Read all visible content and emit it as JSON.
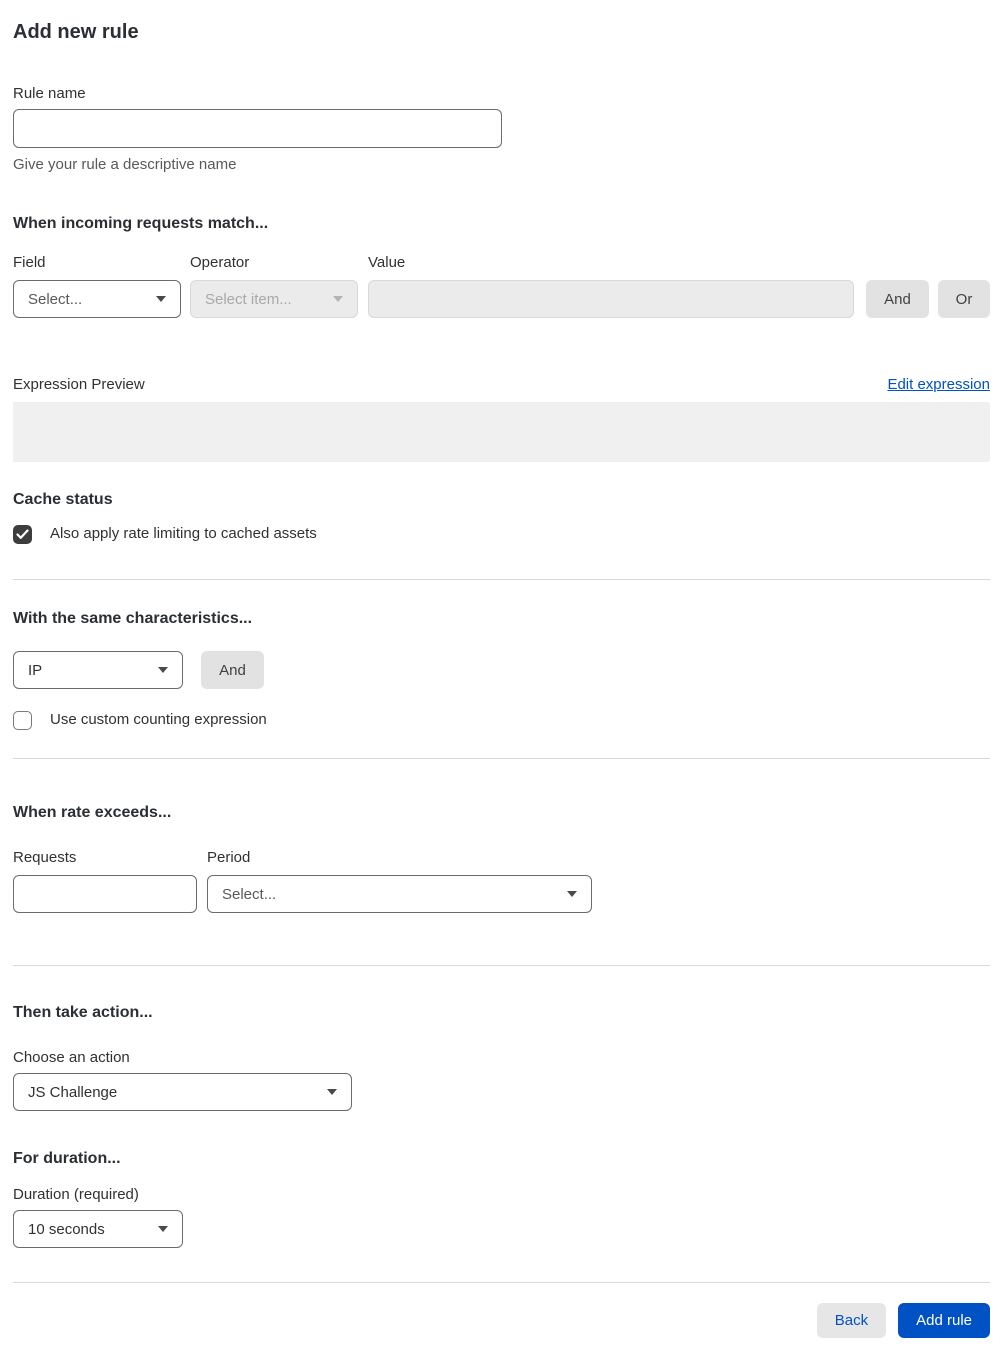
{
  "page": {
    "title": "Add new rule"
  },
  "rule_name": {
    "label": "Rule name",
    "value": "",
    "placeholder": "",
    "helper": "Give your rule a descriptive name"
  },
  "match_section": {
    "heading": "When incoming requests match...",
    "field": {
      "label": "Field",
      "selected": "Select..."
    },
    "operator": {
      "label": "Operator",
      "selected": "Select item...",
      "disabled": true
    },
    "value": {
      "label": "Value",
      "value": "",
      "disabled": true
    },
    "and_button": "And",
    "or_button": "Or"
  },
  "expression": {
    "label": "Expression Preview",
    "edit_link": "Edit expression",
    "preview_value": ""
  },
  "cache_section": {
    "heading": "Cache status",
    "checkbox_label": "Also apply rate limiting to cached assets",
    "checked": true
  },
  "characteristics_section": {
    "heading": "With the same characteristics...",
    "characteristic": {
      "selected": "IP"
    },
    "and_button": "And",
    "checkbox_label": "Use custom counting expression",
    "checked": false
  },
  "rate_section": {
    "heading": "When rate exceeds...",
    "requests": {
      "label": "Requests",
      "value": ""
    },
    "period": {
      "label": "Period",
      "selected": "Select..."
    }
  },
  "action_section": {
    "heading": "Then take action...",
    "label": "Choose an action",
    "selected": "JS Challenge"
  },
  "duration_section": {
    "heading": "For duration...",
    "label": "Duration (required)",
    "selected": "10 seconds"
  },
  "footer": {
    "back_button": "Back",
    "add_rule_button": "Add rule"
  },
  "colors": {
    "accent_blue": "#0051c3",
    "heading_text": "#2b2f33",
    "body_text": "#313131",
    "muted_text": "#595959",
    "disabled_bg": "#ebebeb",
    "disabled_border": "#d9d9d9",
    "button_gray": "#e2e2e2",
    "expression_box_bg": "#f0f0f0",
    "divider": "#d9d9d9",
    "checkbox_checked": "#3d3d3d"
  }
}
